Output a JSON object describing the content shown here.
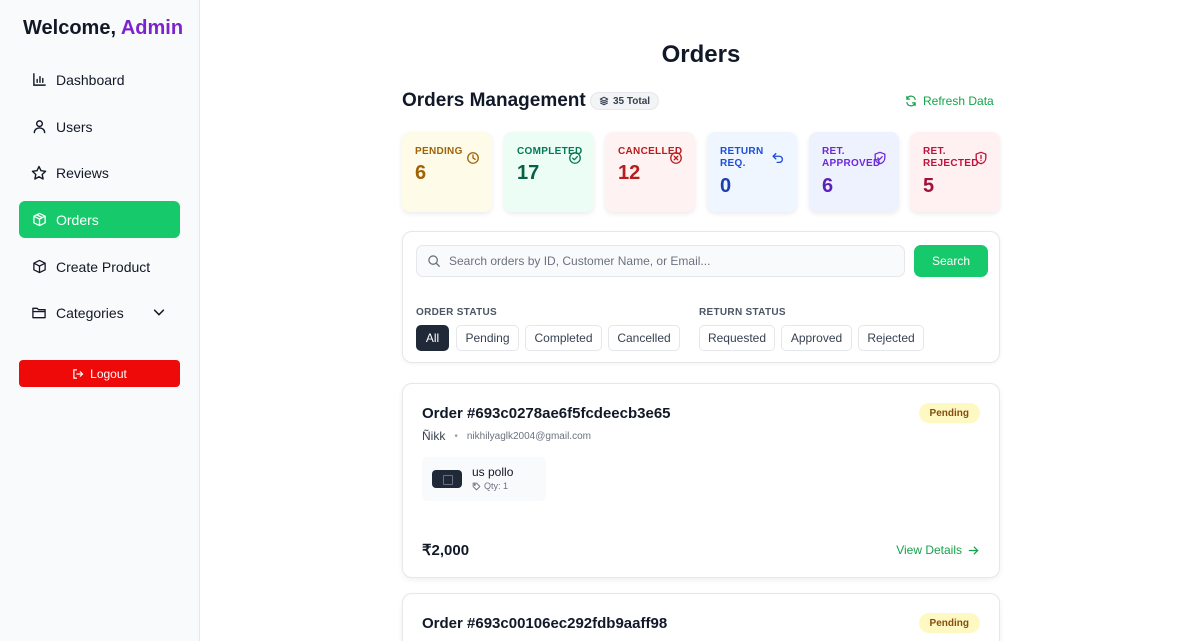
{
  "sidebar": {
    "welcome_prefix": "Welcome,",
    "welcome_name": "Admin",
    "items": [
      {
        "label": "Dashboard",
        "icon": "bar-chart-icon"
      },
      {
        "label": "Users",
        "icon": "user-icon"
      },
      {
        "label": "Reviews",
        "icon": "star-icon"
      },
      {
        "label": "Orders",
        "icon": "package-icon",
        "active": true
      },
      {
        "label": "Create Product",
        "icon": "box-icon"
      },
      {
        "label": "Categories",
        "icon": "folder-icon",
        "has_dropdown": true
      }
    ],
    "logout_label": "Logout"
  },
  "header": {
    "page_title": "Orders",
    "section_title": "Orders Management",
    "total_badge": "35 Total",
    "refresh_label": "Refresh Data"
  },
  "stats": [
    {
      "label": "PENDING",
      "value": "6",
      "icon": "clock-icon",
      "bg": "#fefce8",
      "color": "#a16207",
      "value_color": "#a16207"
    },
    {
      "label": "COMPLETED",
      "value": "17",
      "icon": "check-circle-icon",
      "bg": "#ecfdf5",
      "color": "#047857",
      "value_color": "#065f46"
    },
    {
      "label": "CANCELLED",
      "value": "12",
      "icon": "x-circle-icon",
      "bg": "#fef2f2",
      "color": "#b91c1c",
      "value_color": "#b91c1c"
    },
    {
      "label": "RETURN REQ.",
      "value": "0",
      "icon": "undo-icon",
      "bg": "#eff6ff",
      "color": "#1d4ed8",
      "value_color": "#1e40af"
    },
    {
      "label": "RET. APPROVED",
      "value": "6",
      "icon": "shield-check-icon",
      "bg": "#eef2ff",
      "color": "#6d28d9",
      "value_color": "#5b21b6"
    },
    {
      "label": "RET. REJECTED",
      "value": "5",
      "icon": "shield-alert-icon",
      "bg": "#fff1f2",
      "color": "#be123c",
      "value_color": "#9f1239"
    }
  ],
  "search": {
    "placeholder": "Search orders by ID, Customer Name, or Email...",
    "value": "",
    "button_label": "Search"
  },
  "filters": {
    "order_status_label": "ORDER STATUS",
    "order_status_options": [
      "All",
      "Pending",
      "Completed",
      "Cancelled"
    ],
    "order_status_selected": "All",
    "return_status_label": "RETURN STATUS",
    "return_status_options": [
      "Requested",
      "Approved",
      "Rejected"
    ]
  },
  "orders": [
    {
      "id": "Order #693c0278ae6f5fcdeecb3e65",
      "status": "Pending",
      "customer": "Ñikk",
      "email": "nikhilyaglk2004@gmail.com",
      "item_name": "us pollo",
      "item_qty": "Qty: 1",
      "price": "₹2,000",
      "view_label": "View Details"
    },
    {
      "id": "Order #693c00106ec292fdb9aaff98",
      "status": "Pending"
    }
  ]
}
